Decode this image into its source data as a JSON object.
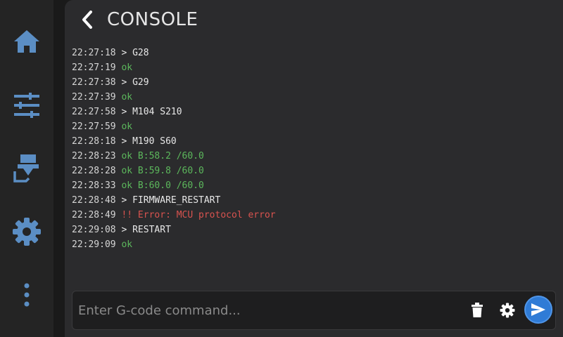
{
  "header": {
    "title": "CONSOLE"
  },
  "sidebar": {
    "items": [
      {
        "icon": "home-icon"
      },
      {
        "icon": "sliders-icon"
      },
      {
        "icon": "extruder-icon"
      },
      {
        "icon": "gear-icon"
      },
      {
        "icon": "more-vertical-icon"
      }
    ]
  },
  "console": {
    "lines": [
      {
        "time": "22:27:18",
        "text": "> G28",
        "kind": "command"
      },
      {
        "time": "22:27:19",
        "text": "ok",
        "kind": "ok"
      },
      {
        "time": "22:27:38",
        "text": "> G29",
        "kind": "command"
      },
      {
        "time": "22:27:39",
        "text": "ok",
        "kind": "ok"
      },
      {
        "time": "22:27:58",
        "text": "> M104 S210",
        "kind": "command"
      },
      {
        "time": "22:27:59",
        "text": "ok",
        "kind": "ok"
      },
      {
        "time": "22:28:18",
        "text": "> M190 S60",
        "kind": "command"
      },
      {
        "time": "22:28:23",
        "text": "ok B:58.2 /60.0",
        "kind": "ok"
      },
      {
        "time": "22:28:28",
        "text": "ok B:59.8 /60.0",
        "kind": "ok"
      },
      {
        "time": "22:28:33",
        "text": "ok B:60.0 /60.0",
        "kind": "ok"
      },
      {
        "time": "22:28:48",
        "text": "> FIRMWARE_RESTART",
        "kind": "command"
      },
      {
        "time": "22:28:49",
        "text": "!! Error: MCU protocol error",
        "kind": "error"
      },
      {
        "time": "22:29:08",
        "text": "> RESTART",
        "kind": "command"
      },
      {
        "time": "22:29:09",
        "text": "ok",
        "kind": "ok"
      }
    ]
  },
  "input": {
    "placeholder": "Enter G-code command...",
    "value": ""
  },
  "colors": {
    "accent": "#5b8ec4",
    "ok": "#5cb85c",
    "error": "#d9534f",
    "send": "#2f7bd6"
  }
}
